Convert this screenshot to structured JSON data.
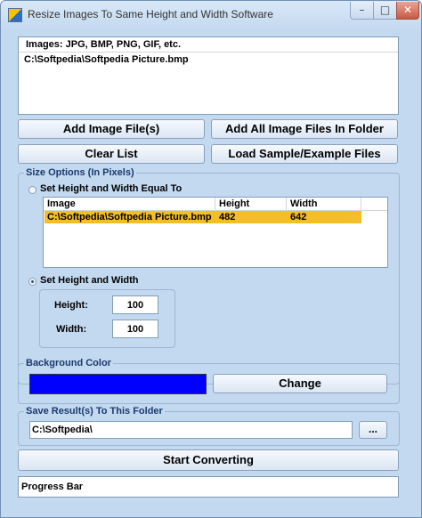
{
  "window": {
    "title": "Resize Images To Same Height and Width Software"
  },
  "file_list": {
    "header": "Images: JPG, BMP, PNG, GIF, etc.",
    "items": [
      "C:\\Softpedia\\Softpedia Picture.bmp"
    ]
  },
  "buttons": {
    "add_files": "Add Image File(s)",
    "add_folder": "Add All Image Files In Folder",
    "clear_list": "Clear List",
    "load_sample": "Load Sample/Example Files",
    "change": "Change",
    "browse": "...",
    "start": "Start Converting"
  },
  "size_options": {
    "legend": "Size Options (In Pixels)",
    "option_equal": "Set Height and Width Equal To",
    "option_set": "Set Height and Width",
    "selected_option": "option_set",
    "table": {
      "columns": [
        "Image",
        "Height",
        "Width"
      ],
      "rows": [
        {
          "image": "C:\\Softpedia\\Softpedia Picture.bmp",
          "height": "482",
          "width": "642"
        }
      ]
    },
    "height_label": "Height:",
    "height_value": "100",
    "width_label": "Width:",
    "width_value": "100"
  },
  "background": {
    "legend": "Background Color",
    "color": "#0000ff"
  },
  "save": {
    "legend": "Save Result(s) To This Folder",
    "folder": "C:\\Softpedia\\"
  },
  "progress": {
    "label": "Progress Bar"
  }
}
